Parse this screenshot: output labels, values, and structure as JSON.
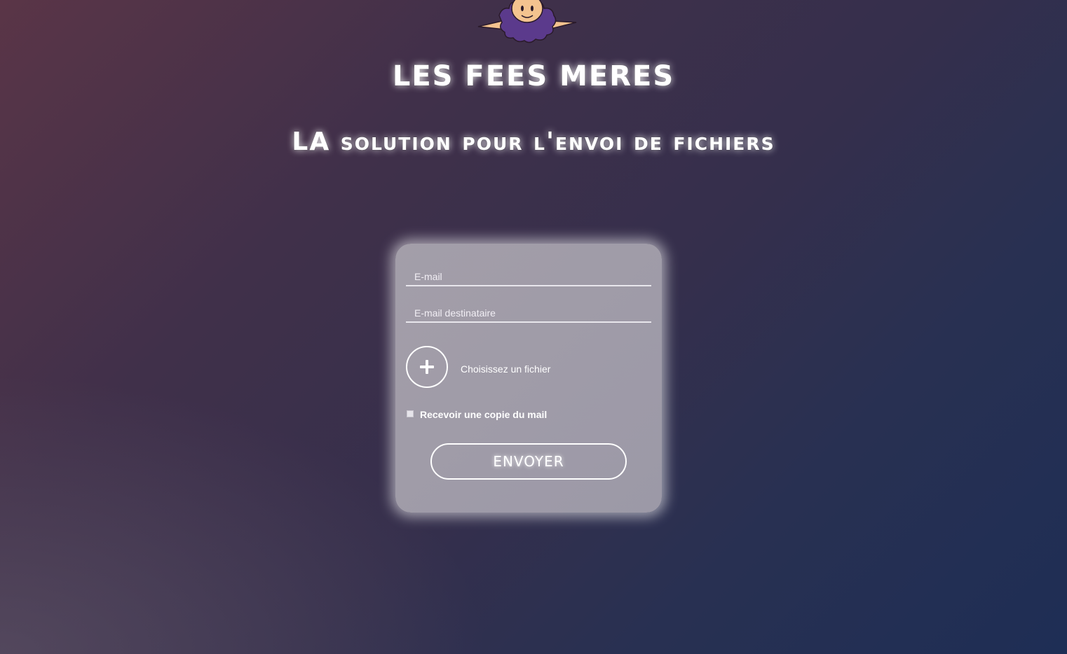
{
  "header": {
    "title": "LES FEES MERES",
    "subtitle": "LA solution pour l'envoi de fichiers"
  },
  "form": {
    "email_placeholder": "E-mail",
    "recipient_placeholder": "E-mail destinataire",
    "file_label": "Choisissez un fichier",
    "copy_checkbox_label": "Recevoir une copie du mail",
    "copy_checked": false,
    "submit_label": "ENVOYER"
  },
  "icons": {
    "logo": "fairy-mascot-icon",
    "file": "plus-icon"
  },
  "colors": {
    "mascot_hair": "#5b3a8c",
    "mascot_skin": "#f4c38f",
    "text": "#ffffff"
  }
}
